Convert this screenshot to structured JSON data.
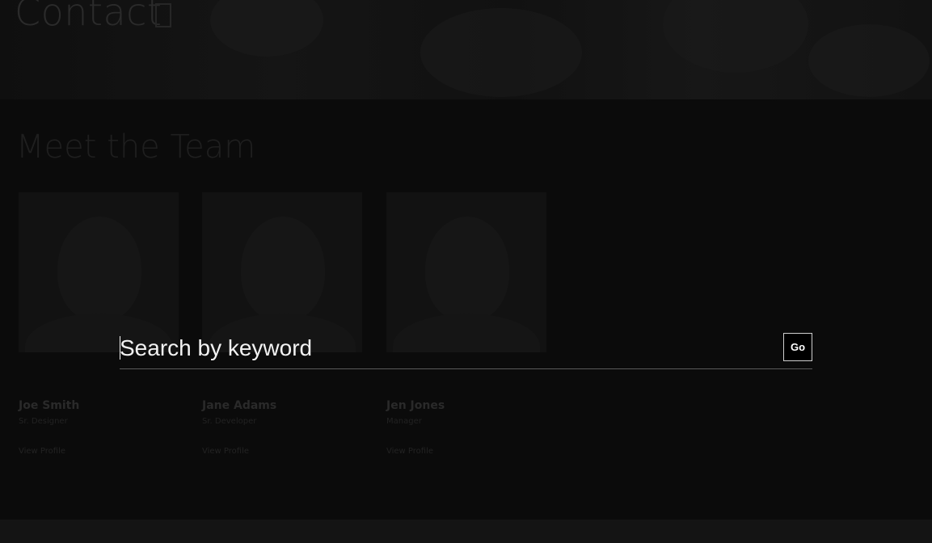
{
  "hero": {
    "title": "Contact"
  },
  "main": {
    "section_title": "Meet the Team",
    "team": [
      {
        "name": "Joe Smith",
        "role": "Sr. Designer",
        "profile_link": "View Profile"
      },
      {
        "name": "Jane Adams",
        "role": "Sr. Developer",
        "profile_link": "View Profile"
      },
      {
        "name": "Jen Jones",
        "role": "Manager",
        "profile_link": "View Profile"
      }
    ]
  },
  "search": {
    "placeholder": "Search by keyword",
    "go_label": "Go"
  },
  "colors": {
    "overlay_background": "#0b0b0b",
    "overlay_text": "#f2f2f2",
    "button_border": "#cfcfcf"
  }
}
